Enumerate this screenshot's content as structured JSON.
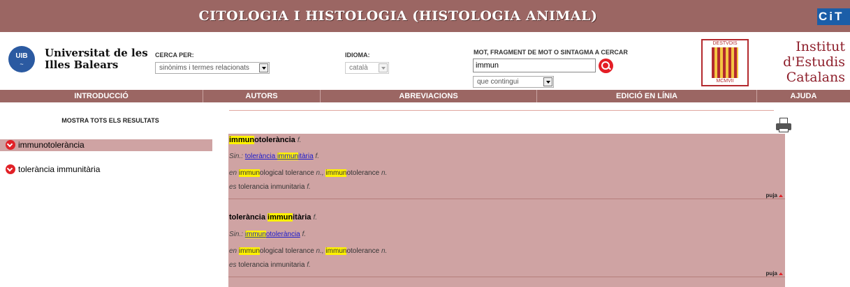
{
  "header": {
    "title": "CITOLOGIA I HISTOLOGIA (HISTOLOGIA ANIMAL)",
    "cit_logo": "CiT"
  },
  "uib": {
    "logo_text": "UIB",
    "name_line1": "Universitat de les",
    "name_line2": "Illes Balears"
  },
  "search": {
    "cerca_label": "CERCA PER:",
    "cerca_value": "sinònims i termes relacionats",
    "idioma_label": "IDIOMA:",
    "idioma_value": "català",
    "mot_label": "MOT, FRAGMENT DE MOT O SINTAGMA A CERCAR",
    "query": "immun",
    "mode_value": "que contingui"
  },
  "iec": {
    "shield_top": "DESTVDIS",
    "shield_bottom": "MCMVII",
    "name_line1": "Institut",
    "name_line2": "d'Estudis",
    "name_line3": "Catalans"
  },
  "nav": {
    "items": [
      {
        "label": "INTRODUCCIÓ"
      },
      {
        "label": "AUTORS"
      },
      {
        "label": "ABREVIACIONS"
      },
      {
        "label": "EDICIÓ EN LÍNIA"
      },
      {
        "label": "AJUDA"
      }
    ]
  },
  "sidebar": {
    "title": "MOSTRA TOTS ELS RESULTATS",
    "items": [
      {
        "label": "immunotolerància",
        "active": true
      },
      {
        "label": "tolerància immunitària",
        "active": false
      }
    ]
  },
  "entries": [
    {
      "head_pre": "",
      "head_hl": "immun",
      "head_post": "otolerància",
      "head_gender": "f.",
      "sin_label": "Sin.:",
      "sin_pre": "tolerància ",
      "sin_hl": "immun",
      "sin_post": "itària",
      "sin_gender": "f.",
      "en_label": "en",
      "en1_hl": "immun",
      "en1_post": "ological tolerance",
      "en1_pos": "n.,",
      "en2_hl": "immun",
      "en2_post": "otolerance",
      "en2_pos": "n.",
      "es_label": "es",
      "es_text": "tolerancia inmunitaria",
      "es_gender": "f.",
      "puja": "puja"
    },
    {
      "head_pre": "tolerància ",
      "head_hl": "immun",
      "head_post": "itària",
      "head_gender": "f.",
      "sin_label": "Sin.:",
      "sin_pre": "",
      "sin_hl": "immun",
      "sin_post": "otolerància",
      "sin_gender": "f.",
      "en_label": "en",
      "en1_hl": "immun",
      "en1_post": "ological tolerance",
      "en1_pos": "n.,",
      "en2_hl": "immun",
      "en2_post": "otolerance",
      "en2_pos": "n.",
      "es_label": "es",
      "es_text": "tolerancia inmunitaria",
      "es_gender": "f.",
      "puja": "puja"
    }
  ]
}
